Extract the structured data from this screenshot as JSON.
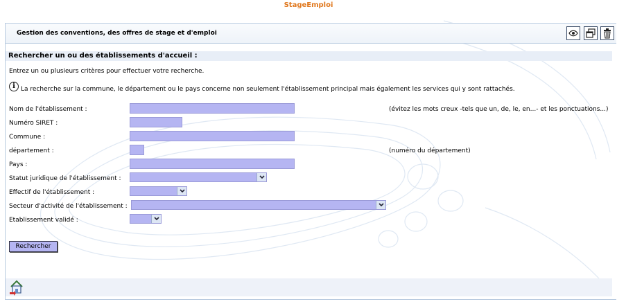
{
  "app": {
    "title": "StageEmploi"
  },
  "header": {
    "title": "Gestion des conventions, des offres de stage et d'emploi",
    "icons": [
      "eye-icon",
      "windows-icon",
      "trash-icon"
    ]
  },
  "section": {
    "title": "Rechercher un ou des établissements d'accueil :",
    "intro": "Entrez un ou plusieurs critères pour effectuer votre recherche.",
    "info": "La recherche sur la commune, le département ou le pays concerne non seulement l'établissement principal mais également les services qui y sont rattachés."
  },
  "form": {
    "nom_label": "Nom de l'établissement :",
    "nom_hint": "(évitez les mots creux -tels que un, de, le, en...- et les ponctuations...)",
    "siret_label": "Numéro SIRET :",
    "commune_label": "Commune :",
    "departement_label": "département :",
    "departement_hint": "(numéro du département)",
    "pays_label": "Pays :",
    "statut_label": "Statut juridique de l'établissement :",
    "effectif_label": "Effectif de l'établissement :",
    "secteur_label": "Secteur d'activité de l'établissement :",
    "valide_label": "Etablissement validé :",
    "search_button": "Rechercher"
  },
  "colors": {
    "accent": "#e0781e",
    "field": "#b5b5f2",
    "border": "#b9cbe0"
  }
}
